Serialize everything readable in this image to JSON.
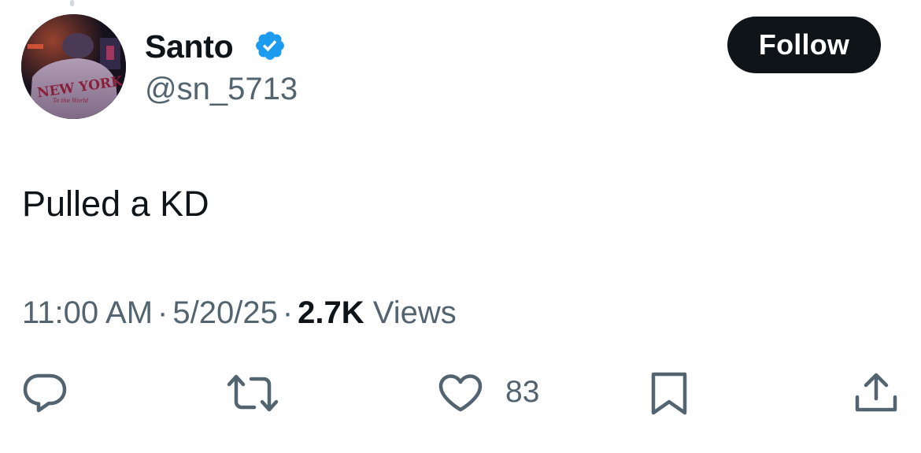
{
  "author": {
    "display_name": "Santo",
    "handle": "@sn_5713",
    "verified": true,
    "verified_color": "#1d9bf0"
  },
  "follow_button": {
    "label": "Follow"
  },
  "tweet": {
    "text": "Pulled a KD",
    "time": "11:00 AM",
    "date": "5/20/25",
    "separator": "·",
    "views_count": "2.7K",
    "views_label": "Views"
  },
  "actions": {
    "like_count": "83",
    "icons": [
      "reply-icon",
      "retweet-icon",
      "like-icon",
      "bookmark-icon",
      "share-icon"
    ]
  },
  "colors": {
    "text_primary": "#0f1419",
    "text_secondary": "#536471",
    "button_bg": "#0f1419"
  }
}
